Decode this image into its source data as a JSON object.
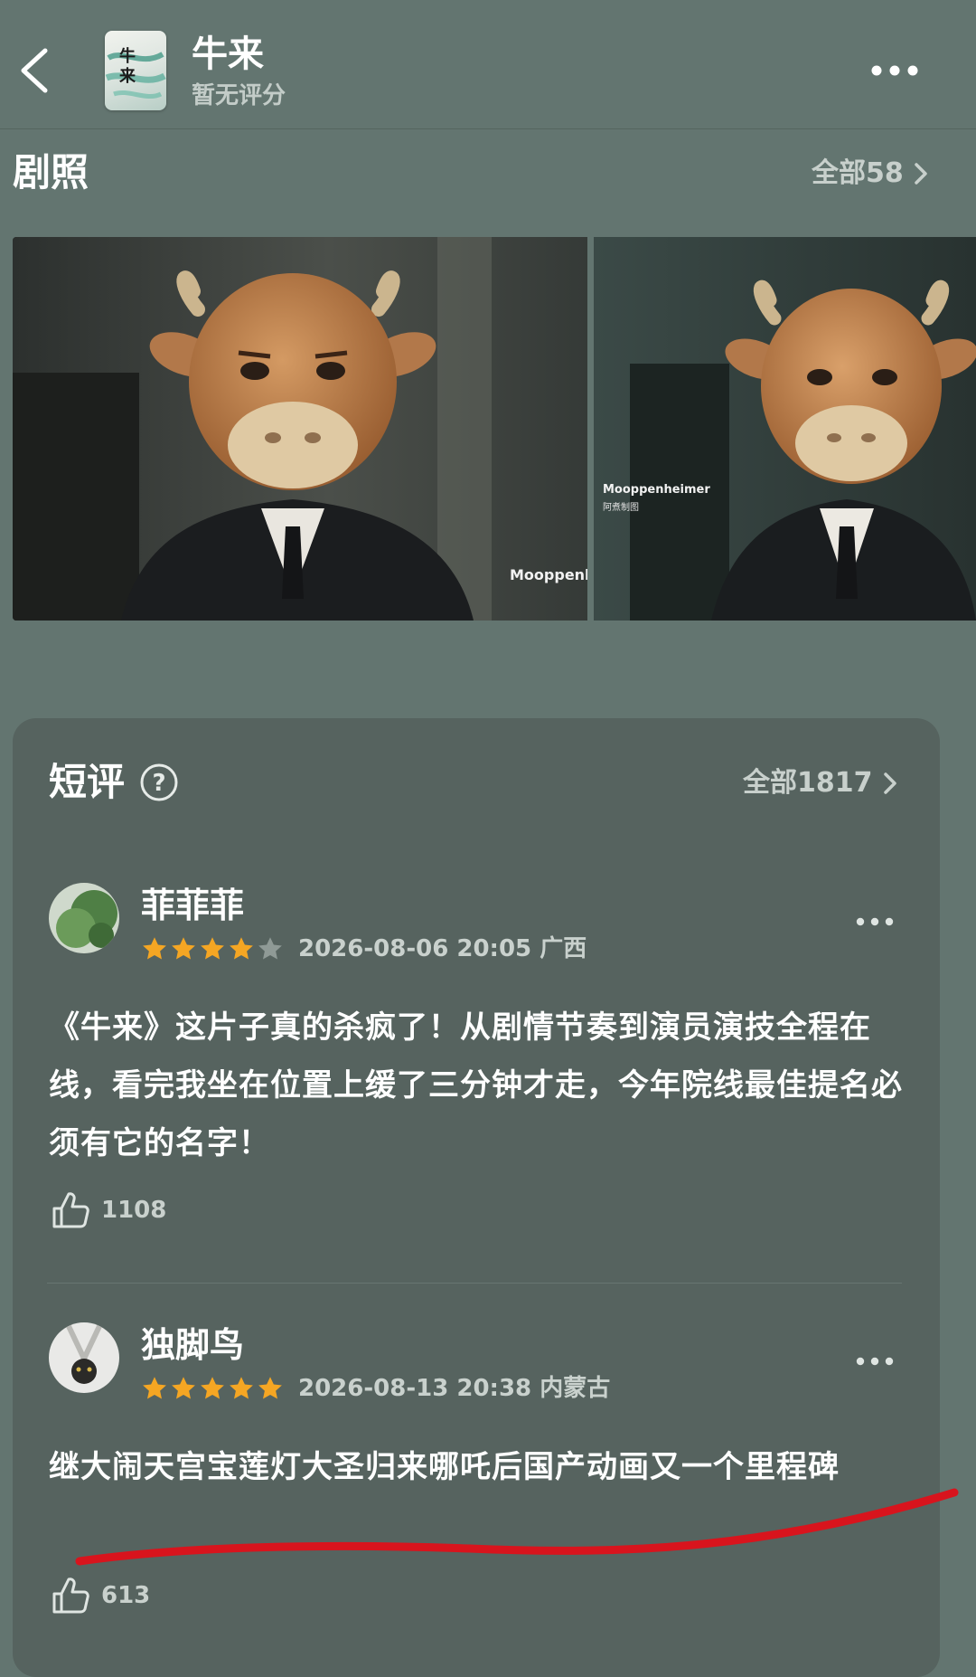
{
  "header": {
    "title": "牛来",
    "subtitle": "暂无评分",
    "poster_text": "牛来"
  },
  "stills": {
    "title": "剧照",
    "see_all": "全部58",
    "watermark1": "Mooppenl",
    "watermark2": "Mooppenheimer",
    "watermark2_sub": "阿煮制图"
  },
  "reviews": {
    "title": "短评",
    "see_all": "全部1817",
    "items": [
      {
        "user": "菲菲菲",
        "rating": 4,
        "date": "2026-08-06 20:05",
        "location": "广西",
        "text": "《牛来》这片子真的杀疯了！从剧情节奏到演员演技全程在线，看完我坐在位置上缓了三分钟才走，今年院线最佳提名必须有它的名字！",
        "likes": "1108"
      },
      {
        "user": "独脚鸟",
        "rating": 5,
        "date": "2026-08-13 20:38",
        "location": "内蒙古",
        "text": "继大闹天宫宝莲灯大圣归来哪吒后国产动画又一个里程碑",
        "likes": "613"
      }
    ]
  },
  "colors": {
    "background": "#637570",
    "card": "#56635f",
    "star": "#f5a623",
    "annotation": "#d8141d"
  },
  "icons": [
    "back-arrow-icon",
    "more-icon",
    "chevron-right-icon",
    "help-icon",
    "star-icon",
    "thumbs-up-icon"
  ]
}
